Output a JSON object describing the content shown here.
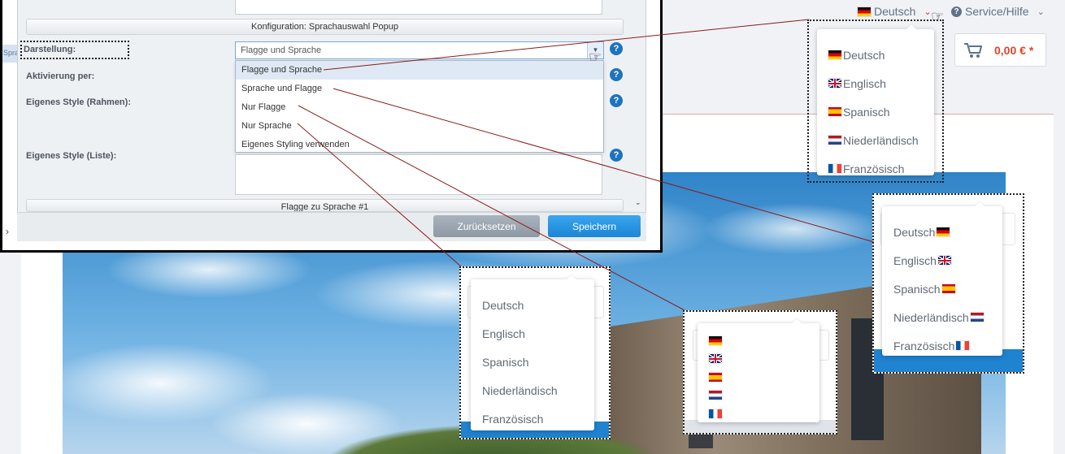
{
  "storefront": {
    "nav": {
      "language": "Deutsch",
      "service": "Service/Hilfe"
    },
    "cart": {
      "price": "0,00 € *"
    }
  },
  "admin": {
    "section_title": "Konfiguration: Sprachauswahl Popup",
    "left_tab": "Spra",
    "fields": {
      "darstellung": "Darstellung:",
      "aktivierung": "Aktivierung per:",
      "style_rahmen": "Eigenes Style (Rahmen):",
      "style_liste": "Eigenes Style (Liste):"
    },
    "select_value": "Flagge und Sprache",
    "options": [
      "Flagge und Sprache",
      "Sprache und Flagge",
      "Nur Flagge",
      "Nur Sprache",
      "Eigenes Styling verwenden"
    ],
    "next_section": "Flagge zu Sprache #1",
    "buttons": {
      "reset": "Zurücksetzen",
      "save": "Speichern"
    }
  },
  "examples": {
    "flag_and_language": [
      {
        "flag": "de",
        "label": "Deutsch"
      },
      {
        "flag": "gb",
        "label": "Englisch"
      },
      {
        "flag": "es",
        "label": "Spanisch"
      },
      {
        "flag": "nl",
        "label": "Niederländisch"
      },
      {
        "flag": "fr",
        "label": "Französisch"
      }
    ],
    "language_and_flag": [
      {
        "flag": "de",
        "label": "Deutsch"
      },
      {
        "flag": "gb",
        "label": "Englisch"
      },
      {
        "flag": "es",
        "label": "Spanisch"
      },
      {
        "flag": "nl",
        "label": "Niederländisch"
      },
      {
        "flag": "fr",
        "label": "Französisch"
      }
    ],
    "only_language": [
      "Deutsch",
      "Englisch",
      "Spanisch",
      "Niederländisch",
      "Französisch"
    ],
    "only_flag": [
      "de",
      "gb",
      "es",
      "nl",
      "fr"
    ]
  },
  "colors": {
    "accent_blue": "#1f83d0",
    "price_red": "#d9482b",
    "connector": "#8b1a1a"
  }
}
